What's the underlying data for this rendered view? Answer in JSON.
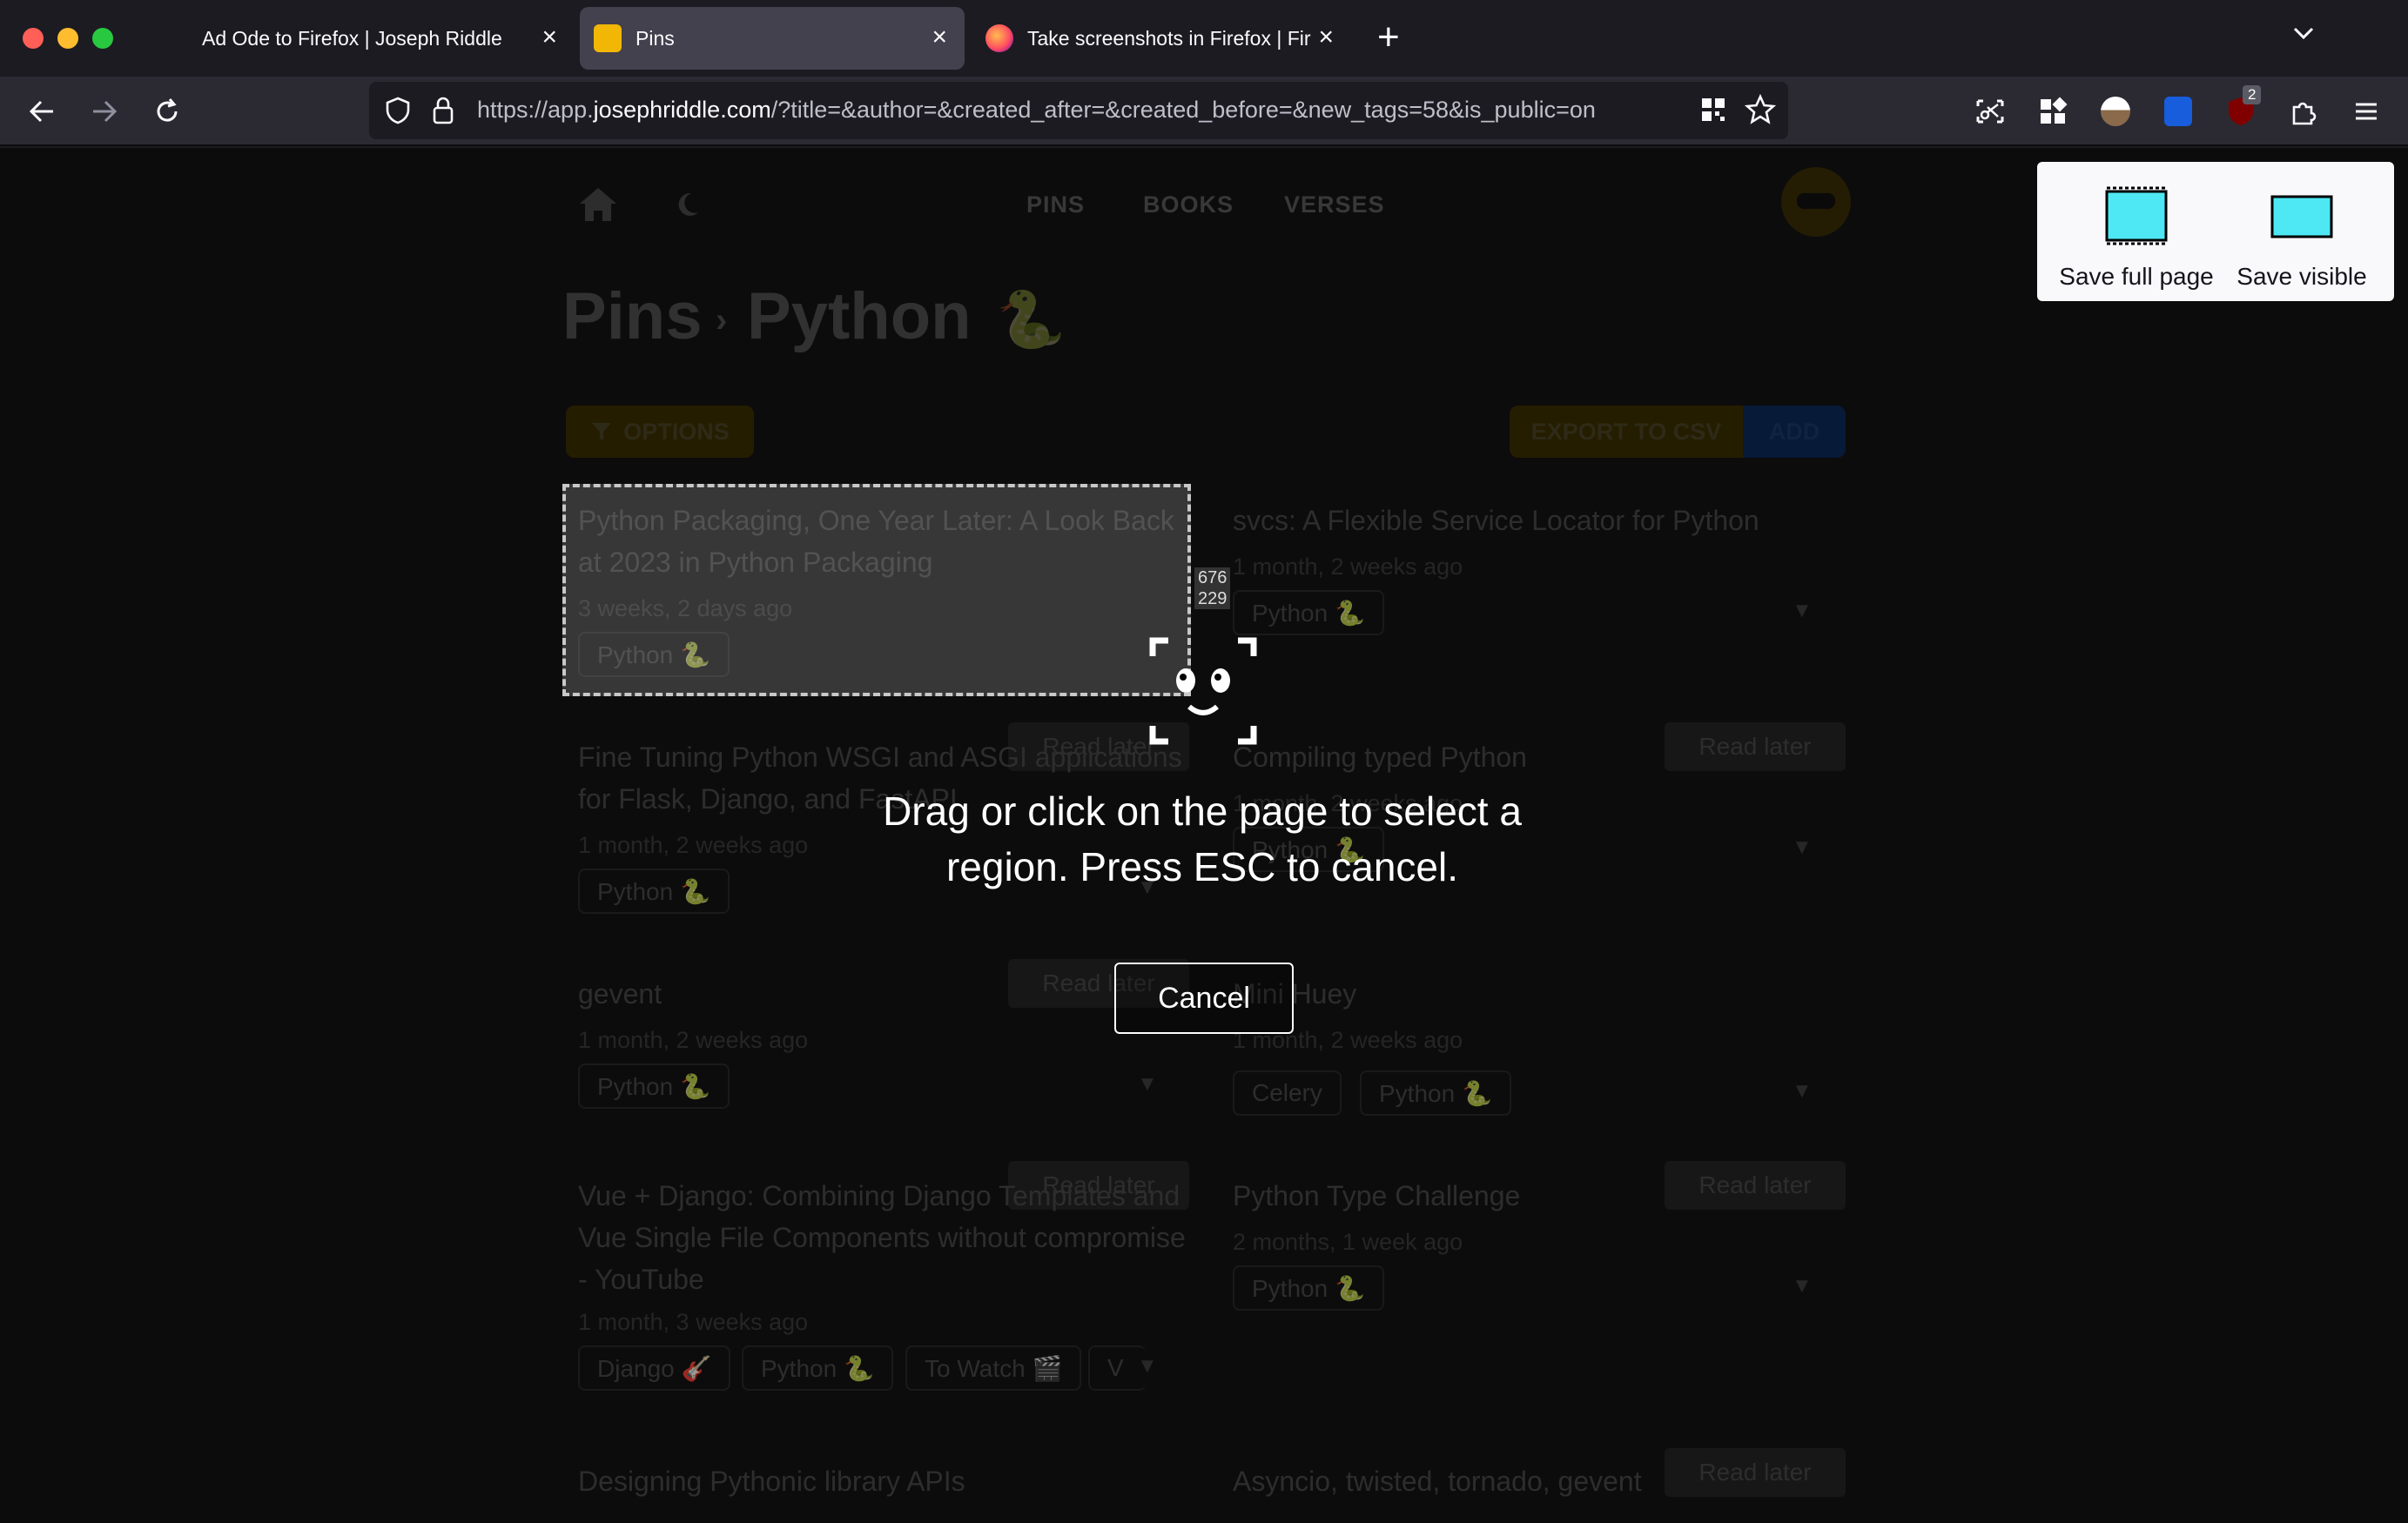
{
  "browser": {
    "tabs": [
      {
        "title": "Ad Ode to Firefox | Joseph Riddle",
        "active": false
      },
      {
        "title": "Pins",
        "active": true
      },
      {
        "title": "Take screenshots in Firefox | Fir",
        "active": false
      }
    ],
    "url_prefix": "https://app.",
    "url_domain": "josephriddle.com",
    "url_rest": "/?title=&author=&created_after=&created_before=&new_tags=58&is_public=on",
    "extension_badge": "2"
  },
  "site": {
    "nav": [
      "PINS",
      "BOOKS",
      "VERSES"
    ],
    "breadcrumb_root": "Pins",
    "breadcrumb_sep": "›",
    "title": "Python",
    "title_emoji": "🐍",
    "options_label": "OPTIONS",
    "export_label": "EXPORT TO CSV",
    "add_label": "ADD",
    "read_later_label": "Read later"
  },
  "pins_left": [
    {
      "title": "Python Packaging, One Year Later: A Look Back at 2023 in Python Packaging",
      "age": "3 weeks, 2 days ago",
      "tags": [
        "Python 🐍"
      ]
    },
    {
      "title": "Fine Tuning Python WSGI and ASGI applications for Flask, Django, and FastAPI",
      "age": "1 month, 2 weeks ago",
      "tags": [
        "Python 🐍"
      ]
    },
    {
      "title": "gevent",
      "age": "1 month, 2 weeks ago",
      "tags": [
        "Python 🐍"
      ]
    },
    {
      "title": "Vue + Django: Combining Django Templates and Vue Single File Components without compromise - YouTube",
      "age": "1 month, 3 weeks ago",
      "tags": [
        "Django 🎸",
        "Python 🐍",
        "To Watch 🎬",
        "V"
      ]
    },
    {
      "title": "Designing Pythonic library APIs",
      "age": "",
      "tags": []
    }
  ],
  "pins_right": [
    {
      "title": "svcs: A Flexible Service Locator for Python",
      "age": "1 month, 2 weeks ago",
      "tags": [
        "Python 🐍"
      ]
    },
    {
      "title": "Compiling typed Python",
      "age": "1 month, 2 weeks ago",
      "tags": [
        "Python 🐍"
      ]
    },
    {
      "title": "Mini Huey",
      "age": "1 month, 2 weeks ago",
      "tags": [
        "Celery",
        "Python 🐍"
      ]
    },
    {
      "title": "Python Type Challenge",
      "age": "2 months, 1 week ago",
      "tags": [
        "Python 🐍"
      ]
    },
    {
      "title": "Asyncio, twisted, tornado, gevent",
      "age": "",
      "tags": []
    }
  ],
  "screenshot_tool": {
    "selection_size_w": "676",
    "selection_size_h": "229",
    "message_line1": "Drag or click on the page to select a",
    "message_line2": "region. Press ESC to cancel.",
    "cancel_label": "Cancel",
    "save_full_page": "Save full page",
    "save_visible": "Save visible"
  },
  "colors": {
    "accent_yellow": "#3d3000",
    "accent_blue": "#0c2a5a",
    "screenshot_icon": "#4ee8f4"
  }
}
